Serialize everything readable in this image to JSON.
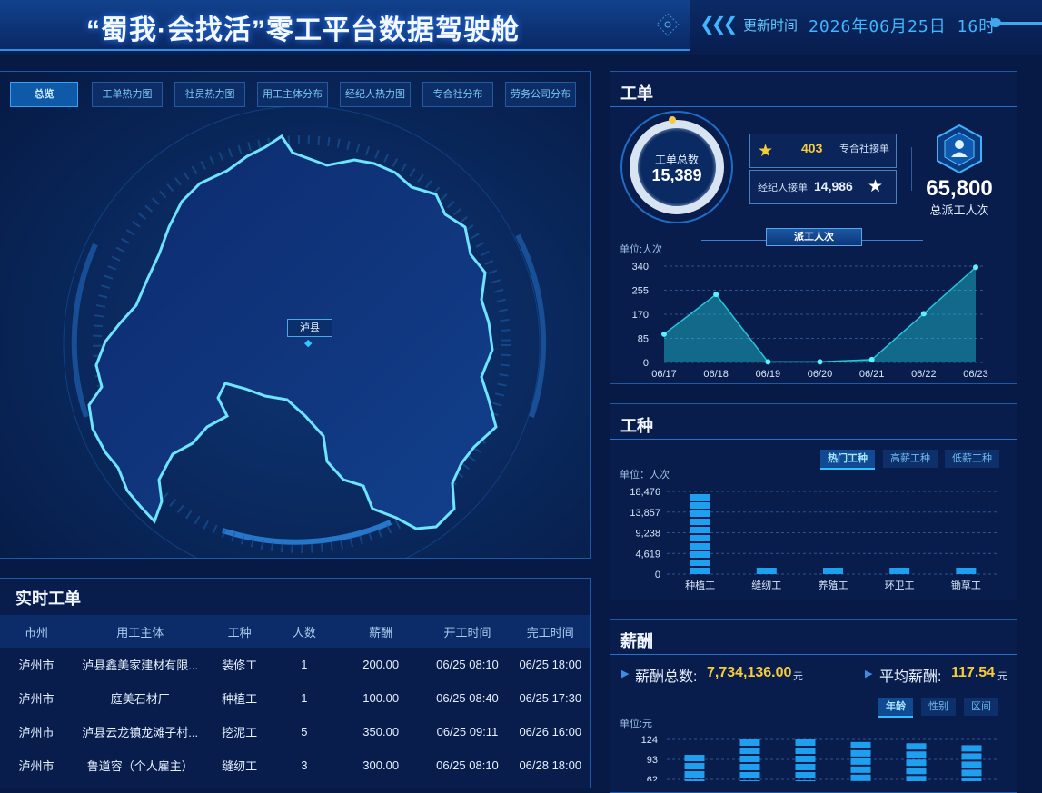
{
  "header": {
    "title": "“蜀我·会找活”零工平台数据驾驶舱",
    "update_label": "更新时间",
    "update_value": "2026年06月25日 16时"
  },
  "map": {
    "tabs": [
      "总览",
      "工单热力图",
      "社员热力图",
      "用工主体分布",
      "经纪人热力图",
      "专合社分布",
      "劳务公司分布"
    ],
    "active_tab": "总览",
    "pin_label": "泸县"
  },
  "realtime": {
    "title": "实时工单",
    "columns": [
      "市州",
      "用工主体",
      "工种",
      "人数",
      "薪酬",
      "开工时间",
      "完工时间"
    ],
    "rows": [
      [
        "泸州市",
        "泸县鑫美家建材有限...",
        "装修工",
        "1",
        "200.00",
        "06/25 08:10",
        "06/25 18:00"
      ],
      [
        "泸州市",
        "庭美石材厂",
        "种植工",
        "1",
        "100.00",
        "06/25 08:40",
        "06/25 17:30"
      ],
      [
        "泸州市",
        "泸县云龙镇龙滩子村...",
        "挖泥工",
        "5",
        "350.00",
        "06/25 09:11",
        "06/26 16:00"
      ],
      [
        "泸州市",
        "鲁道容（个人雇主）",
        "缝纫工",
        "3",
        "300.00",
        "06/25 08:10",
        "06/28 18:00"
      ]
    ]
  },
  "work_order": {
    "title": "工单",
    "total_label": "工单总数",
    "total_value": "15,389",
    "coop_value": "403",
    "coop_label": "专合社接单",
    "agent_label": "经纪人接单",
    "agent_value": "14,986",
    "dispatch_total": "65,800",
    "dispatch_total_label": "总派工人次",
    "dispatch_tab": "派工人次",
    "unit_label": "单位:人次"
  },
  "job_kind": {
    "title": "工种",
    "chips": [
      "热门工种",
      "高薪工种",
      "低薪工种"
    ],
    "active_chip": "热门工种",
    "unit_label": "单位：人次"
  },
  "salary": {
    "title": "薪酬",
    "total_label": "薪酬总数:",
    "total_value": "7,734,136.00",
    "total_unit": "元",
    "avg_label": "平均薪酬:",
    "avg_value": "117.54",
    "avg_unit": "元",
    "chips": [
      "年龄",
      "性别",
      "区间"
    ],
    "active_chip": "年龄",
    "unit_label": "单位:元"
  },
  "chart_data": [
    {
      "type": "area",
      "title": "派工人次",
      "ylabel": "单位:人次",
      "categories": [
        "06/17",
        "06/18",
        "06/19",
        "06/20",
        "06/21",
        "06/22",
        "06/23"
      ],
      "values": [
        100,
        240,
        2,
        2,
        10,
        172,
        336
      ],
      "yticks": [
        0,
        85,
        170,
        255,
        340
      ],
      "ylim": [
        0,
        340
      ],
      "color": "#22c7d8"
    },
    {
      "type": "bar",
      "title": "热门工种",
      "ylabel": "单位：人次",
      "categories": [
        "种植工",
        "缝纫工",
        "养殖工",
        "环卫工",
        "锄草工"
      ],
      "values": [
        17800,
        2600,
        2500,
        2200,
        1900
      ],
      "yticks": [
        "0",
        "4,619",
        "9,238",
        "13,857",
        "18,476"
      ],
      "ylim": [
        0,
        18476
      ],
      "color": "#1ea0f0"
    },
    {
      "type": "bar",
      "title": "年龄",
      "ylabel": "单位:元",
      "values": [
        100,
        124,
        124,
        120,
        118,
        115
      ],
      "yticks_visible": [
        "124",
        "93",
        "62"
      ],
      "ylim": [
        0,
        124
      ],
      "color": "#1ea0f0"
    }
  ]
}
